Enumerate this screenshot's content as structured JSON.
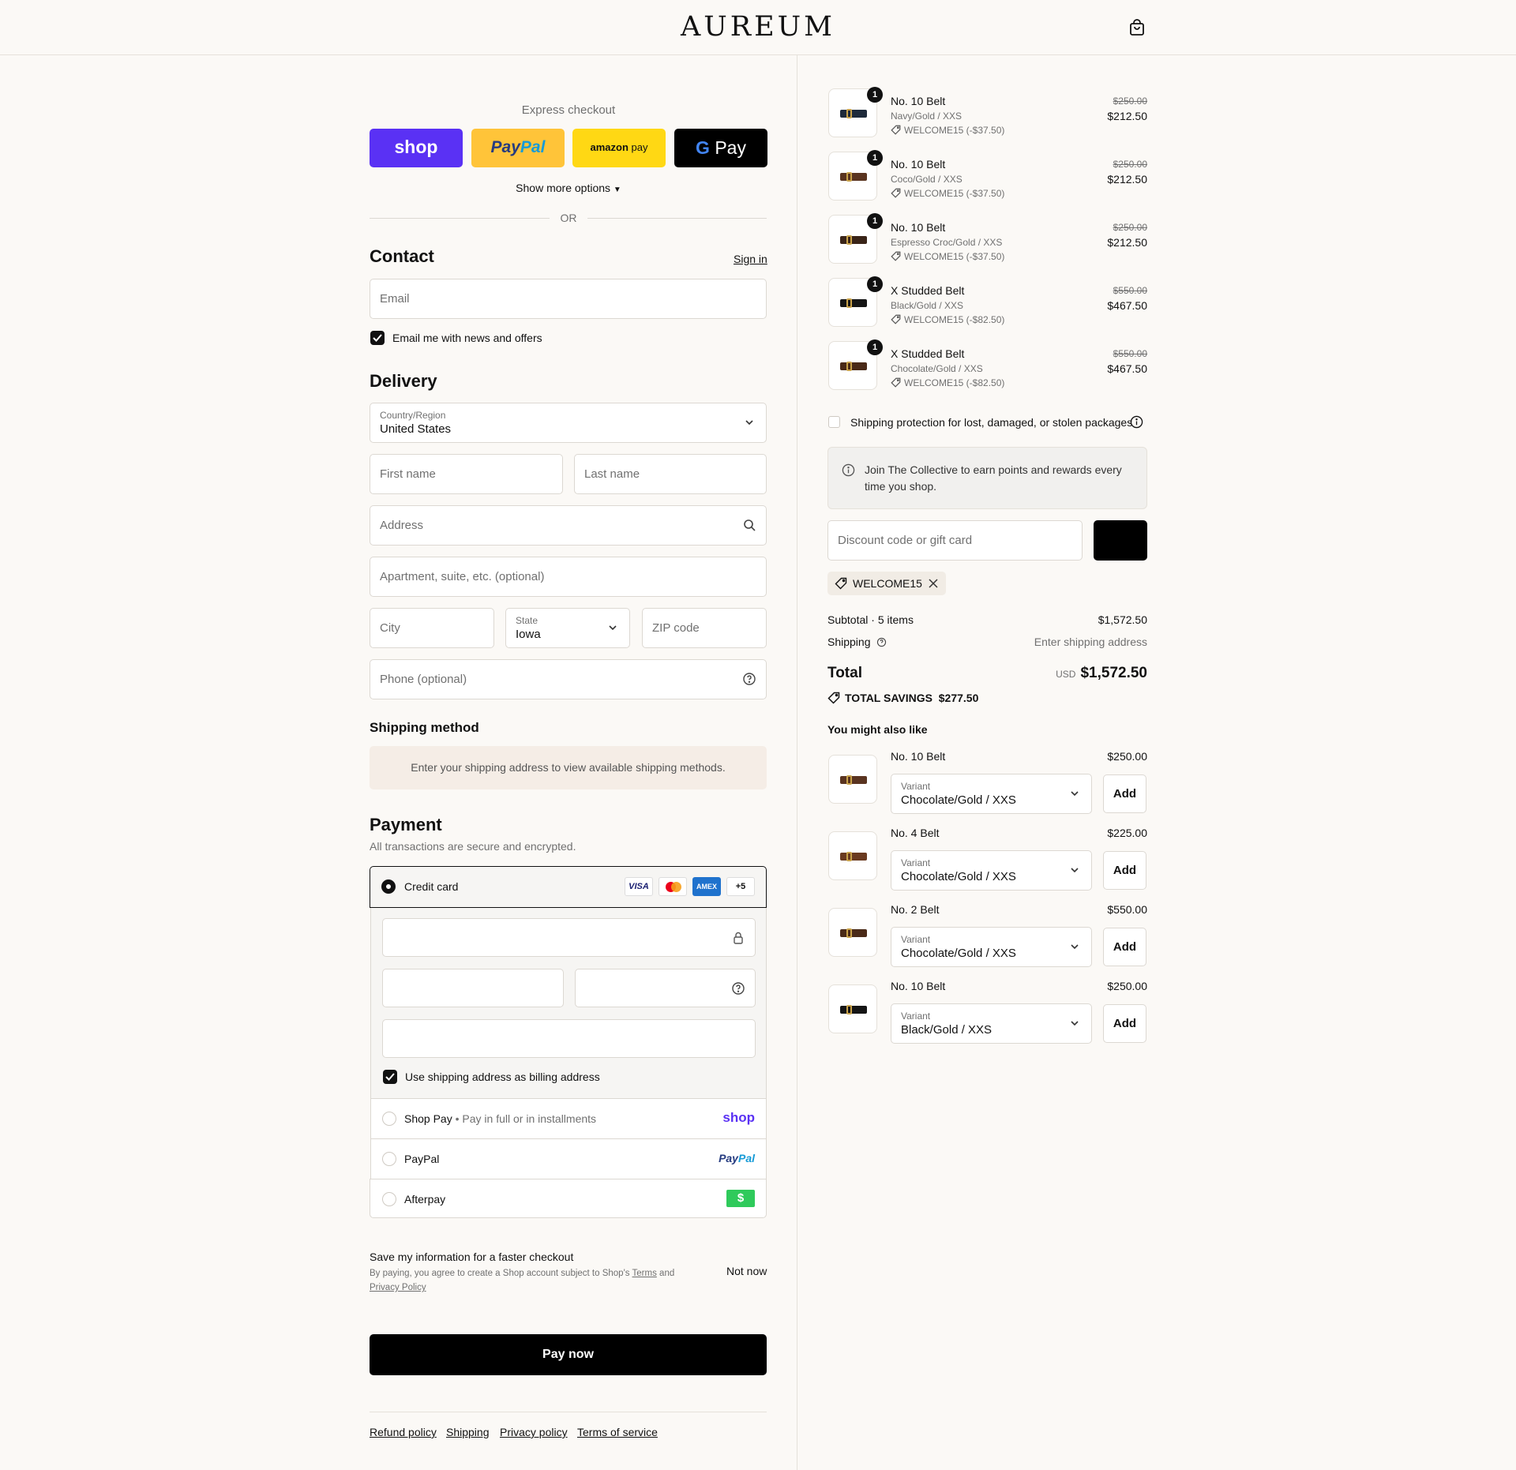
{
  "header": {
    "logo": "AUREUM",
    "cart_icon": "shopping-bag-icon"
  },
  "express": {
    "title": "Express checkout",
    "shop_label": "shop",
    "paypal_label_1": "Pay",
    "paypal_label_2": "Pal",
    "amazon_label_1": "amazon",
    "amazon_label_2": "pay",
    "gpay_label": "Pay",
    "show_more": "Show more options",
    "or": "OR"
  },
  "contact": {
    "heading": "Contact",
    "sign_in": "Sign in",
    "email_placeholder": "Email",
    "news_label": "Email me with news and offers"
  },
  "delivery": {
    "heading": "Delivery",
    "country_label": "Country/Region",
    "country_value": "United States",
    "first_name": "First name",
    "last_name": "Last name",
    "address": "Address",
    "apartment": "Apartment, suite, etc. (optional)",
    "city": "City",
    "state_label": "State",
    "state_value": "Iowa",
    "zip": "ZIP code",
    "phone": "Phone (optional)"
  },
  "shipping_method": {
    "heading": "Shipping method",
    "notice": "Enter your shipping address to view available shipping methods."
  },
  "payment": {
    "heading": "Payment",
    "subtitle": "All transactions are secure and encrypted.",
    "credit_card": "Credit card",
    "visa": "VISA",
    "amex": "AMEX",
    "more_cards": "+5",
    "billing_label": "Use shipping address as billing address",
    "shop_pay": "Shop Pay",
    "shop_pay_sub": "Pay in full or in installments",
    "shop_pay_logo": "shop",
    "paypal": "PayPal",
    "paypal_logo_1": "Pay",
    "paypal_logo_2": "Pal",
    "afterpay": "Afterpay",
    "afterpay_logo": "$"
  },
  "save_info": {
    "title": "Save my information for a faster checkout",
    "text": "By paying, you agree to create a Shop account subject to Shop's",
    "terms": "Terms",
    "and": "and",
    "privacy": "Privacy Policy",
    "not_now": "Not now"
  },
  "pay_now": "Pay now",
  "footer_links": [
    "Refund policy",
    "Shipping",
    "Privacy policy",
    "Terms of service"
  ],
  "cart_items": [
    {
      "qty": "1",
      "name": "No. 10 Belt",
      "variant": "Navy/Gold / XXS",
      "discount": "WELCOME15 (-$37.50)",
      "original": "$250.00",
      "price": "$212.50"
    },
    {
      "qty": "1",
      "name": "No. 10 Belt",
      "variant": "Coco/Gold / XXS",
      "discount": "WELCOME15 (-$37.50)",
      "original": "$250.00",
      "price": "$212.50"
    },
    {
      "qty": "1",
      "name": "No. 10 Belt",
      "variant": "Espresso Croc/Gold / XXS",
      "discount": "WELCOME15 (-$37.50)",
      "original": "$250.00",
      "price": "$212.50"
    },
    {
      "qty": "1",
      "name": "X Studded Belt",
      "variant": "Black/Gold / XXS",
      "discount": "WELCOME15 (-$82.50)",
      "original": "$550.00",
      "price": "$467.50"
    },
    {
      "qty": "1",
      "name": "X Studded Belt",
      "variant": "Chocolate/Gold / XXS",
      "discount": "WELCOME15 (-$82.50)",
      "original": "$550.00",
      "price": "$467.50"
    }
  ],
  "protection": "Shipping protection for lost, damaged, or stolen packages",
  "collective": "Join The Collective to earn points and rewards every time you shop.",
  "discount": {
    "placeholder": "Discount code or gift card",
    "applied": "WELCOME15"
  },
  "summary": {
    "subtotal_label": "Subtotal · 5 items",
    "subtotal_value": "$1,572.50",
    "shipping_label": "Shipping",
    "shipping_value": "Enter shipping address",
    "total_label": "Total",
    "currency": "USD",
    "total_value": "$1,572.50",
    "savings_label": "TOTAL SAVINGS",
    "savings_value": "$277.50"
  },
  "recommendations": {
    "heading": "You might also like",
    "variant_label": "Variant",
    "add_label": "Add",
    "items": [
      {
        "name": "No. 10 Belt",
        "price": "$250.00",
        "variant": "Chocolate/Gold / XXS"
      },
      {
        "name": "No. 4 Belt",
        "price": "$225.00",
        "variant": "Chocolate/Gold / XXS"
      },
      {
        "name": "No. 2 Belt",
        "price": "$550.00",
        "variant": "Chocolate/Gold / XXS"
      },
      {
        "name": "No. 10 Belt",
        "price": "$250.00",
        "variant": "Black/Gold / XXS"
      }
    ]
  },
  "colors": {
    "shop_purple": "#5a31f4",
    "paypal_yellow": "#ffc439",
    "amazon_yellow": "#ffd814",
    "afterpay_green": "#2fca5b",
    "background": "#fbf9f6"
  }
}
